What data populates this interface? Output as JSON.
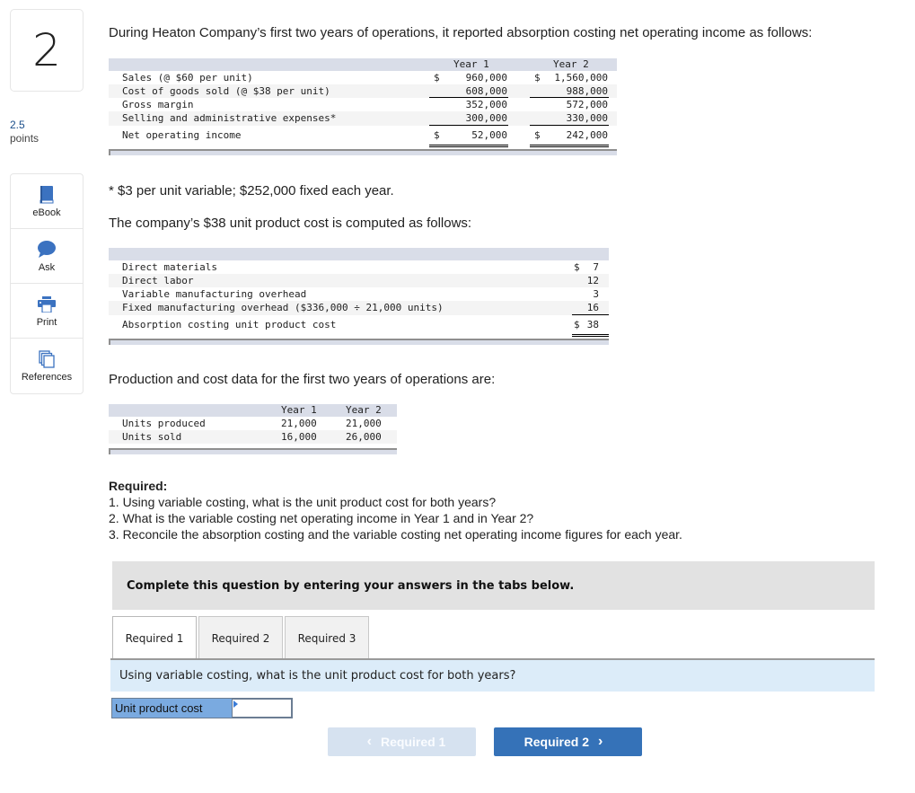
{
  "question": {
    "number": "2",
    "points_value": "2.5",
    "points_label": "points"
  },
  "tools": [
    {
      "label": "eBook",
      "icon": "book-icon"
    },
    {
      "label": "Ask",
      "icon": "chat-bubble-icon"
    },
    {
      "label": "Print",
      "icon": "printer-icon"
    },
    {
      "label": "References",
      "icon": "documents-icon"
    }
  ],
  "intro": "During Heaton Company’s first two years of operations, it reported absorption costing net operating income as follows:",
  "income_table": {
    "headers": [
      "Year 1",
      "Year 2"
    ],
    "rows": [
      {
        "label": "Sales (@ $60 per unit)",
        "y1_sym": "$",
        "y1": "960,000",
        "y2_sym": "$",
        "y2": "1,560,000"
      },
      {
        "label": "Cost of goods sold (@ $38 per unit)",
        "y1_sym": "",
        "y1": "608,000",
        "y2_sym": "",
        "y2": "988,000"
      },
      {
        "label": "Gross margin",
        "y1_sym": "",
        "y1": "352,000",
        "y2_sym": "",
        "y2": "572,000"
      },
      {
        "label": "Selling and administrative expenses*",
        "y1_sym": "",
        "y1": "300,000",
        "y2_sym": "",
        "y2": "330,000"
      },
      {
        "label": "Net operating income",
        "y1_sym": "$",
        "y1": "52,000",
        "y2_sym": "$",
        "y2": "242,000"
      }
    ]
  },
  "footnote": "* $3 per unit variable; $252,000 fixed each year.",
  "unit_cost_intro": "The company’s $38 unit product cost is computed as follows:",
  "unit_cost_table": {
    "rows": [
      {
        "label": "Direct materials",
        "sym": "$",
        "value": "7"
      },
      {
        "label": "Direct labor",
        "sym": "",
        "value": "12"
      },
      {
        "label": "Variable manufacturing overhead",
        "sym": "",
        "value": "3"
      },
      {
        "label": "Fixed manufacturing overhead ($336,000 ÷ 21,000 units)",
        "sym": "",
        "value": "16"
      },
      {
        "label": "Absorption costing unit product cost",
        "sym": "$",
        "value": "38"
      }
    ]
  },
  "production_intro": "Production and cost data for the first two years of operations are:",
  "production_table": {
    "headers": [
      "Year 1",
      "Year 2"
    ],
    "rows": [
      {
        "label": "Units produced",
        "y1": "21,000",
        "y2": "21,000"
      },
      {
        "label": "Units sold",
        "y1": "16,000",
        "y2": "26,000"
      }
    ]
  },
  "required": {
    "heading": "Required:",
    "items": [
      "1. Using variable costing, what is the unit product cost for both years?",
      "2. What is the variable costing net operating income in Year 1 and in Year 2?",
      "3. Reconcile the absorption costing and the variable costing net operating income figures for each year."
    ]
  },
  "banner": "Complete this question by entering your answers in the tabs below.",
  "tabs": [
    {
      "label": "Required 1",
      "active": true
    },
    {
      "label": "Required 2",
      "active": false
    },
    {
      "label": "Required 3",
      "active": false
    }
  ],
  "tab_question": "Using variable costing, what is the unit product cost for both years?",
  "answer": {
    "label": "Unit product cost",
    "value": ""
  },
  "nav": {
    "prev_label": "Required 1",
    "next_label": "Required 2",
    "prev_enabled": false
  },
  "colors": {
    "accent": "#3572b8",
    "accent_disabled": "#d6e2f0",
    "table_header": "#d9dde8",
    "question_bar": "#dcecf9",
    "answer_label": "#7aaae0",
    "banner": "#e2e2e2",
    "points_blue": "#1a4e8a"
  }
}
